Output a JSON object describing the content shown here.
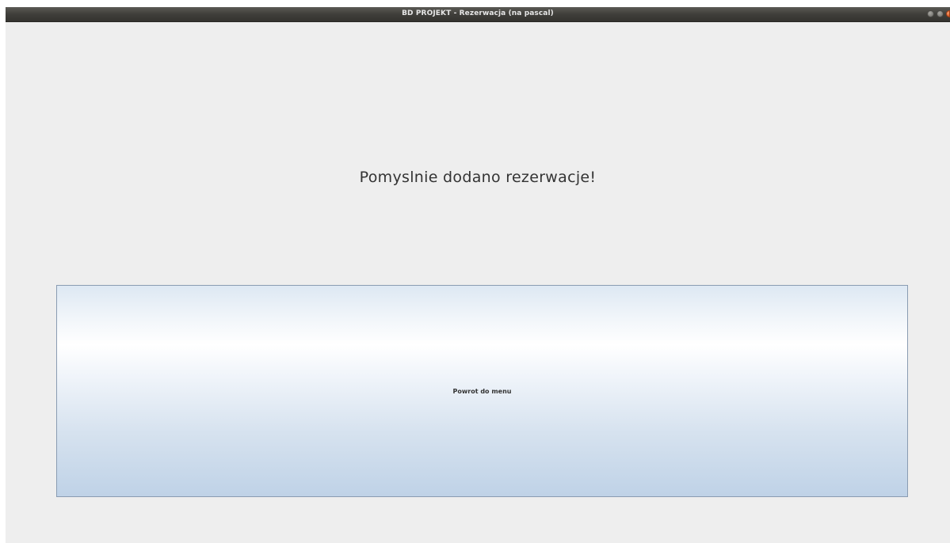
{
  "window": {
    "title": "BD PROJEKT - Rezerwacja (na pascal)"
  },
  "main": {
    "message": "Pomyslnie dodano rezerwacje!",
    "back_button_label": "Powrot do menu"
  },
  "colors": {
    "background": "#eeeeee",
    "titlebar": "#3f3e3a",
    "button_border": "#8a9cb2",
    "button_gradient_bottom": "#bfd2e7"
  }
}
